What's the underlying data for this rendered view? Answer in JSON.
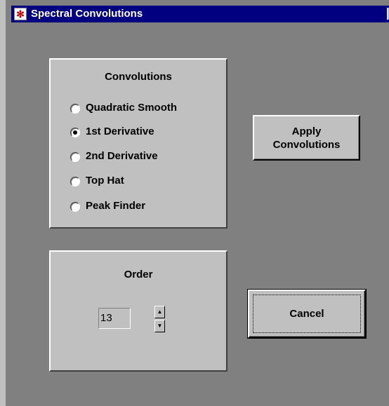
{
  "window": {
    "title": "Spectral Convolutions",
    "close_glyph": "×"
  },
  "convolutions": {
    "title": "Convolutions",
    "options": [
      {
        "label": "Quadratic Smooth",
        "selected": false
      },
      {
        "label": "1st Derivative",
        "selected": true
      },
      {
        "label": "2nd Derivative",
        "selected": false
      },
      {
        "label": "Top Hat",
        "selected": false
      },
      {
        "label": "Peak Finder",
        "selected": false
      }
    ]
  },
  "order": {
    "title": "Order",
    "value": "13",
    "up_glyph": "▲",
    "down_glyph": "▼"
  },
  "buttons": {
    "apply_line1": "Apply",
    "apply_line2": "Convolutions",
    "cancel": "Cancel"
  }
}
